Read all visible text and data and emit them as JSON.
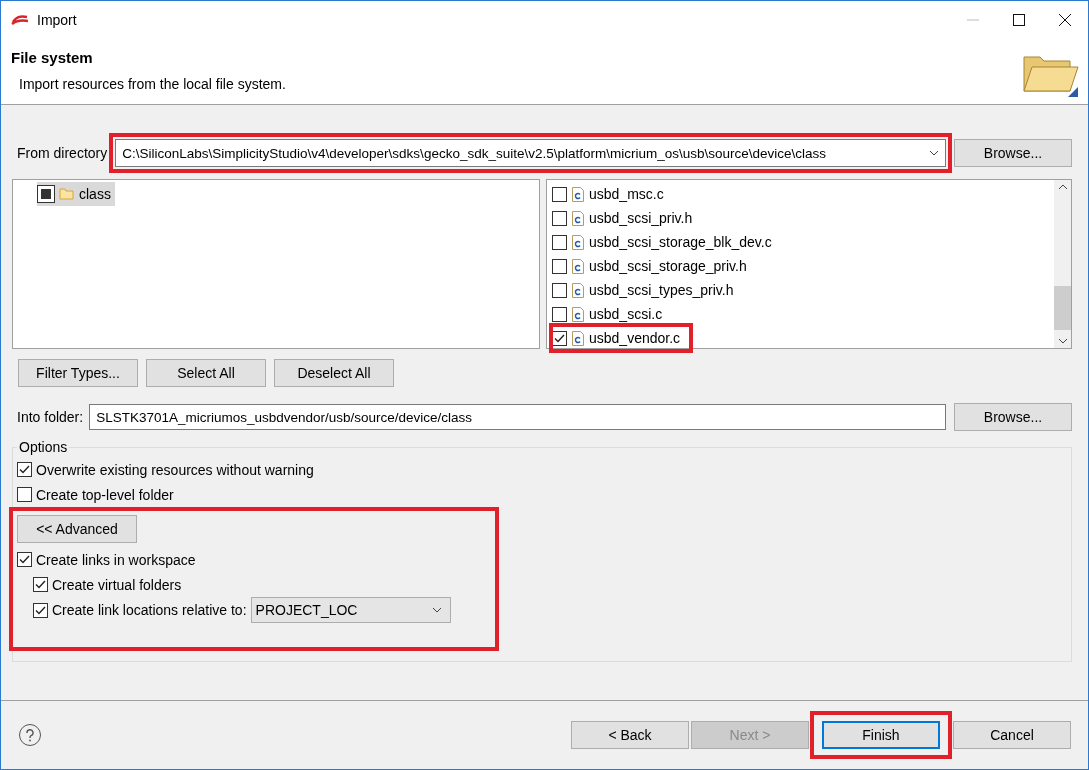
{
  "window": {
    "title": "Import"
  },
  "header": {
    "title": "File system",
    "description": "Import resources from the local file system."
  },
  "from_directory": {
    "label": "From directory",
    "value": "C:\\SiliconLabs\\SimplicityStudio\\v4\\developer\\sdks\\gecko_sdk_suite\\v2.5\\platform\\micrium_os\\usb\\source\\device\\class",
    "browse": "Browse...",
    "highlighted": true
  },
  "folder_tree": [
    {
      "label": "class",
      "checked": true,
      "partial": true,
      "selected": true
    }
  ],
  "files": [
    {
      "name": "usbd_msc.c",
      "checked": false,
      "highlighted": false
    },
    {
      "name": "usbd_scsi_priv.h",
      "checked": false,
      "highlighted": false
    },
    {
      "name": "usbd_scsi_storage_blk_dev.c",
      "checked": false,
      "highlighted": false
    },
    {
      "name": "usbd_scsi_storage_priv.h",
      "checked": false,
      "highlighted": false
    },
    {
      "name": "usbd_scsi_types_priv.h",
      "checked": false,
      "highlighted": false
    },
    {
      "name": "usbd_scsi.c",
      "checked": false,
      "highlighted": false
    },
    {
      "name": "usbd_vendor.c",
      "checked": true,
      "highlighted": true
    }
  ],
  "selection_buttons": [
    "Filter Types...",
    "Select All",
    "Deselect All"
  ],
  "into_folder": {
    "label": "Into folder:",
    "value": "SLSTK3701A_micriumos_usbdvendor/usb/source/device/class",
    "browse": "Browse..."
  },
  "options": {
    "title": "Options",
    "items": [
      {
        "label": "Overwrite existing resources without warning",
        "checked": true
      },
      {
        "label": "Create top-level folder",
        "checked": false
      }
    ],
    "advanced": {
      "button": "<< Advanced",
      "highlighted": true,
      "items": [
        {
          "label": "Create links in workspace",
          "checked": true,
          "children": [
            {
              "label": "Create virtual folders",
              "checked": true
            },
            {
              "label": "Create link locations relative to:",
              "checked": true,
              "relative_to": "PROJECT_LOC"
            }
          ]
        }
      ]
    }
  },
  "footer": {
    "buttons": [
      {
        "label": "< Back",
        "disabled": false,
        "default": false,
        "highlighted": false
      },
      {
        "label": "Next >",
        "disabled": true,
        "default": false,
        "highlighted": false
      },
      {
        "label": "Finish",
        "disabled": false,
        "default": true,
        "highlighted": true
      },
      {
        "label": "Cancel",
        "disabled": false,
        "default": false,
        "highlighted": false
      }
    ]
  }
}
